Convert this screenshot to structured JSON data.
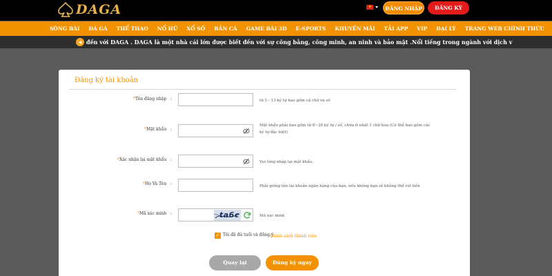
{
  "header": {
    "logo_text": "DAGA",
    "login_label": "ĐĂNG NHẬP",
    "register_label": "ĐĂNG KÝ",
    "language_flag": "vietnam-flag-icon"
  },
  "nav": {
    "items": [
      {
        "label": "SÒNG BÀI"
      },
      {
        "label": "ĐÁ GÀ"
      },
      {
        "label": "THỂ THAO"
      },
      {
        "label": "NỔ HŨ"
      },
      {
        "label": "XỔ SỐ"
      },
      {
        "label": "BẮN CÁ"
      },
      {
        "label": "GAME BÀI 3D"
      },
      {
        "label": "E-SPORTS"
      },
      {
        "label": "KHUYẾN MÃI"
      },
      {
        "label": "TẢI APP"
      },
      {
        "label": "VIP"
      },
      {
        "label": "ĐẠI LÝ"
      },
      {
        "label": "TRANG WEB CHÍNH THỨC"
      }
    ]
  },
  "marquee": {
    "text": "đến với DAGA . DAGA là một nhà cái lớn được biết đến với sự công bằng, công minh, an ninh và bảo mật .Nổi tiếng trong ngành với dịch v"
  },
  "form": {
    "title": "Đăng ký tài khoản",
    "fields": [
      {
        "label": "Tên đăng nhập",
        "colon": ":",
        "value": "",
        "hint": "từ 5 - 13 ký tự bao gồm cả chữ và số"
      },
      {
        "label": "Mật khẩu",
        "colon": ":",
        "value": "",
        "hint": "Mật khẩu phải bao gồm từ 8~20 ký tự / số, chứa ít nhất 1 chữ hoa (Có thể bao gồm các ký tự đặc biệt)"
      },
      {
        "label": "Xác nhận lại mật khẩu",
        "colon": ":",
        "value": "",
        "hint": "Vui lòng nhập lại mật khẩu."
      },
      {
        "label": "Họ Và Tên",
        "colon": ":",
        "value": "",
        "hint": "Phải giống tên tài khoản ngân hàng của bạn, nếu không bạn sẽ không thể rút tiền"
      },
      {
        "label": "Mã xác minh",
        "colon": ":",
        "value": "",
        "hint": "Mã xác minh"
      }
    ],
    "captcha_text": "ta6c",
    "agree_text": "Tôi đã đủ tuổi và đồng ý",
    "agree_link": "Chính sách thành viên",
    "agree_checked": true,
    "back_label": "Quay lại",
    "submit_label": "Đăng ký ngay"
  },
  "colors": {
    "accent": "#f39200",
    "danger": "#e31b1b",
    "header_bg": "#000000",
    "page_bg": "#5b5b5b"
  }
}
